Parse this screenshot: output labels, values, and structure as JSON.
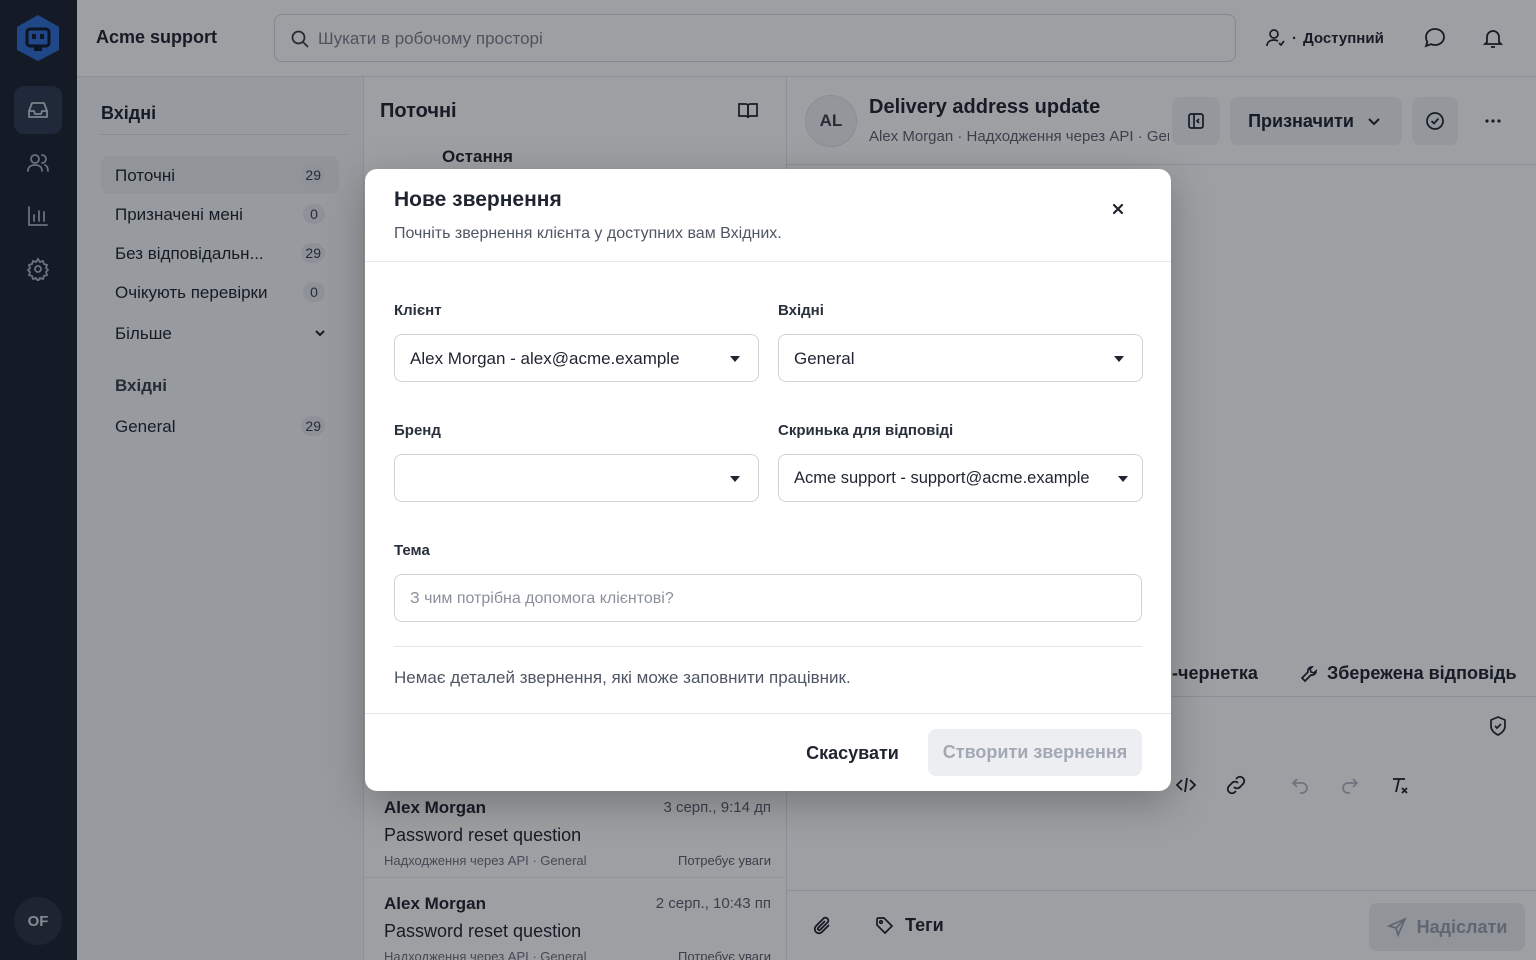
{
  "app": {
    "workspace_name": "Acme support",
    "search_placeholder": "Шукати в робочому просторі",
    "status_label": "Доступний",
    "user_initials": "OF"
  },
  "inbox_nav": {
    "title": "Вхідні",
    "items": [
      {
        "label": "Поточні",
        "count": "29",
        "active": true
      },
      {
        "label": "Призначені мені",
        "count": "0"
      },
      {
        "label": "Без відповідальн...",
        "count": "29"
      },
      {
        "label": "Очікують перевірки",
        "count": "0"
      }
    ],
    "more_label": "Більше",
    "section_title": "Вхідні",
    "inboxes": [
      {
        "label": "General",
        "count": "29"
      }
    ]
  },
  "conversation_list": {
    "title": "Поточні",
    "sort_label": "Остання",
    "rows": [
      {
        "name": "Alex Morgan",
        "time": "3 серп., 9:14 дп",
        "subject": "Password reset question",
        "meta": "Надходження через API · General",
        "flag": "Потребує уваги"
      },
      {
        "name": "Alex Morgan",
        "time": "2 серп., 10:43 пп",
        "subject": "Password reset question",
        "meta": "Надходження через API · General",
        "flag": "Потребує уваги"
      }
    ]
  },
  "detail": {
    "avatar_initials": "AL",
    "title": "Delivery address update",
    "subtitle": "Alex Morgan · Надходження через API · General",
    "assign_label": "Призначити",
    "compose_tab_draft": "-чернетка",
    "compose_tab_saved": "Збережена відповідь",
    "tags_label": "Теги",
    "send_label": "Надіслати"
  },
  "modal": {
    "title": "Нове звернення",
    "description": "Почніть звернення клієнта у доступних вам Вхідних.",
    "customer_label": "Клієнт",
    "customer_value": "Alex Morgan - alex@acme.example",
    "inbox_label": "Вхідні",
    "inbox_value": "General",
    "brand_label": "Бренд",
    "brand_value": "",
    "reply_mailbox_label": "Скринька для відповіді",
    "reply_mailbox_value": "Acme support - support@acme.example",
    "subject_label": "Тема",
    "subject_placeholder": "З чим потрібна допомога клієнтові?",
    "no_details_text": "Немає деталей звернення, які може заповнити працівник.",
    "cancel_label": "Скасувати",
    "create_label": "Створити звернення"
  },
  "icons": {
    "logo": "robot-hex-logo",
    "rail": [
      "inbox-icon",
      "users-icon",
      "bar-chart-icon",
      "gear-icon"
    ]
  },
  "colors": {
    "rail_bg": "#1b2433",
    "logo_blue": "#2f6fd6",
    "overlay": "rgba(10,14,22,0.40)"
  }
}
